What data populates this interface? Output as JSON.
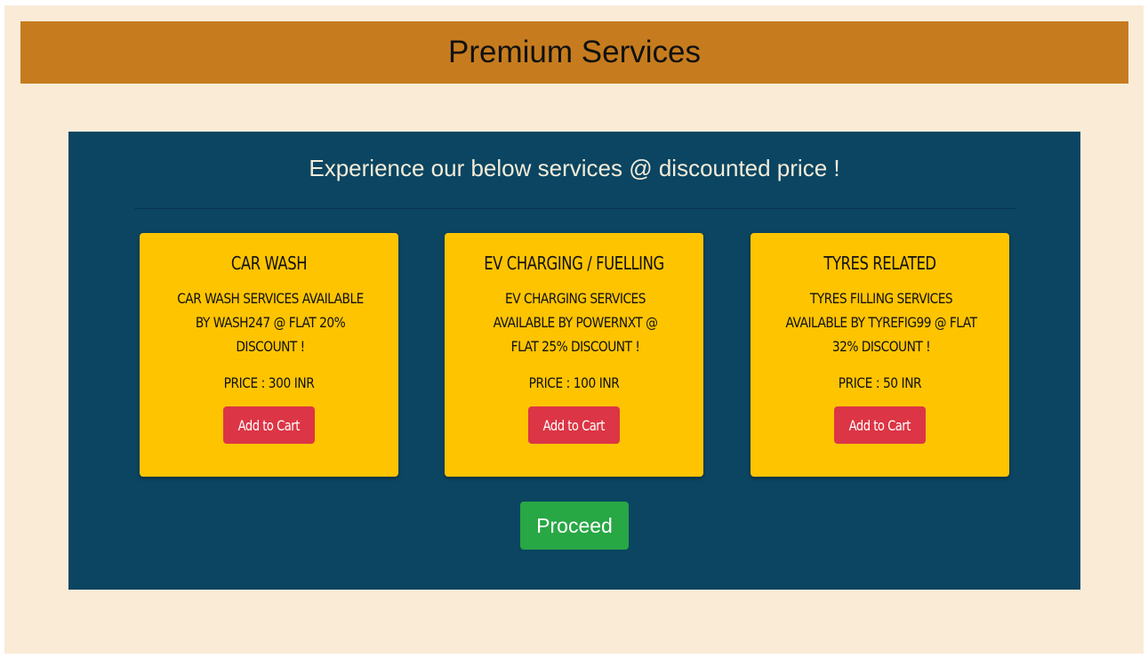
{
  "header": {
    "title": "Premium Services"
  },
  "panel": {
    "heading": "Experience our below services @ discounted price !"
  },
  "cards": [
    {
      "title": "CAR WASH",
      "description": "CAR WASH SERVICES AVAILABLE BY WASH247 @ FLAT 20% DISCOUNT !",
      "price": "PRICE : 300 INR",
      "button_label": "Add to Cart"
    },
    {
      "title": "EV CHARGING / FUELLING",
      "description": "EV CHARGING SERVICES AVAILABLE BY POWERNXT @ FLAT 25% DISCOUNT !",
      "price": "PRICE : 100 INR",
      "button_label": "Add to Cart"
    },
    {
      "title": "TYRES RELATED",
      "description": "TYRES FILLING SERVICES AVAILABLE BY TYREFIG99 @ FLAT 32% DISCOUNT !",
      "price": "PRICE : 50 INR",
      "button_label": "Add to Cart"
    }
  ],
  "proceed_label": "Proceed",
  "colors": {
    "page_background": "#faebd7",
    "header_background": "#c67c1e",
    "panel_background": "#0b4561",
    "card_background": "#ffc400",
    "cart_button": "#dc3545",
    "proceed_button": "#28a745"
  }
}
